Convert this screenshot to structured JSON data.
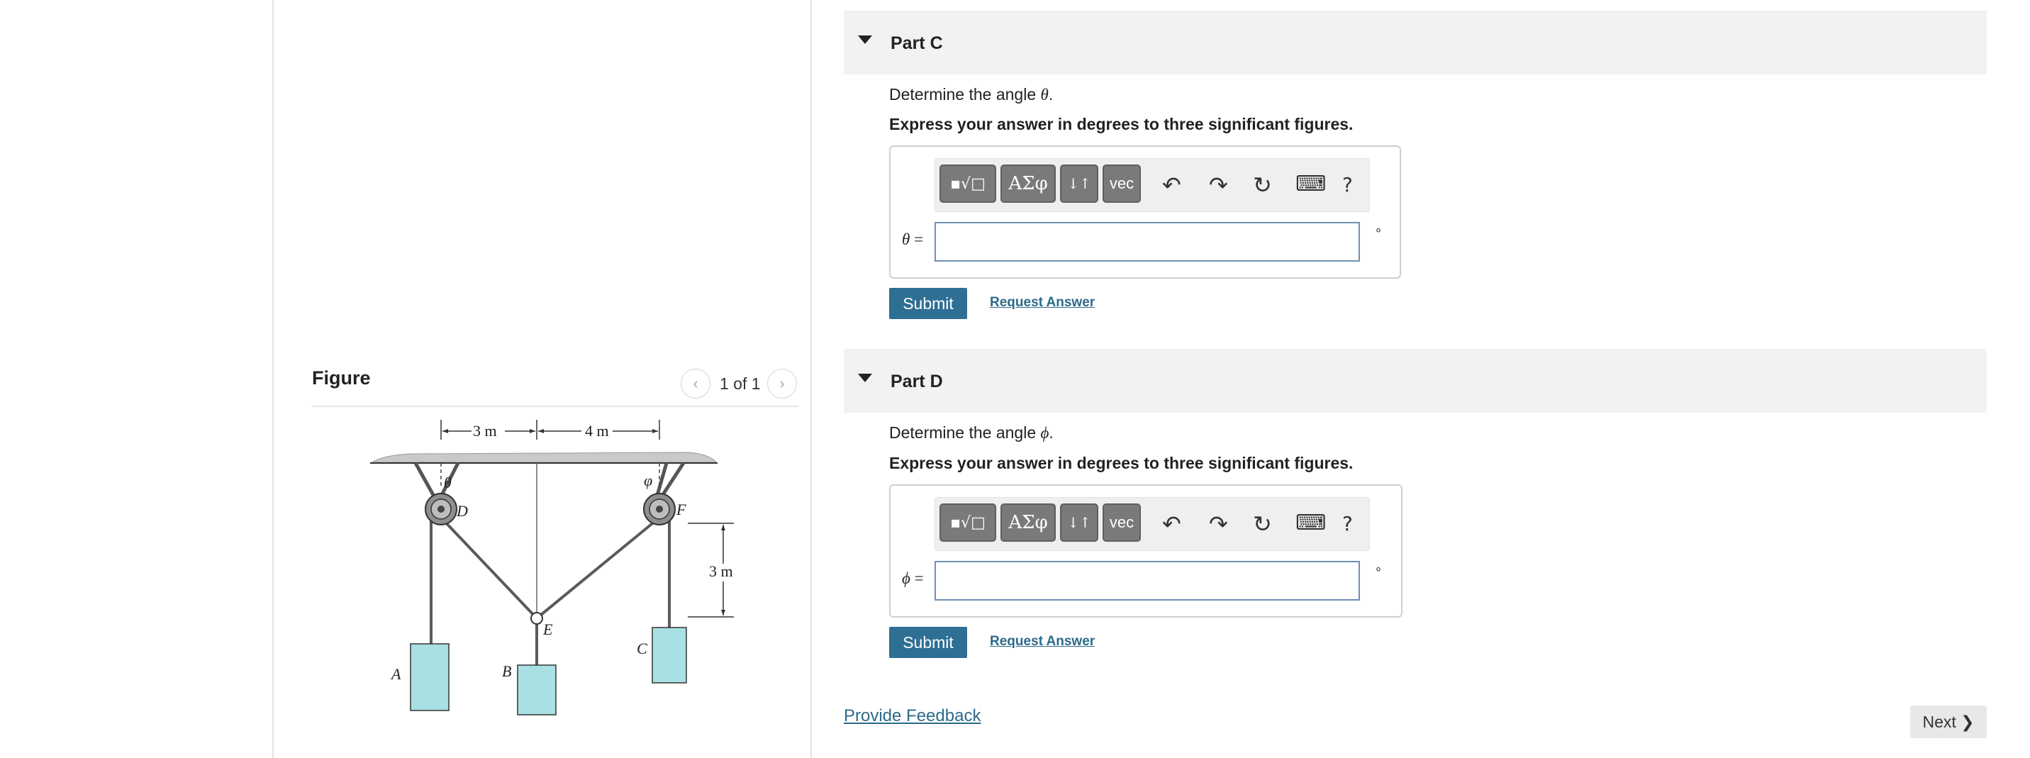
{
  "figure": {
    "title": "Figure",
    "pager": {
      "prev": "‹",
      "count": "1 of 1",
      "next": "›"
    },
    "diagram": {
      "dim_top_left": "3 m",
      "dim_top_right": "4 m",
      "dim_right": "3 m",
      "labels": {
        "theta": "θ",
        "phi": "φ",
        "D": "D",
        "F": "F",
        "E": "E",
        "A": "A",
        "B": "B",
        "C": "C"
      }
    }
  },
  "parts": [
    {
      "title": "Part C",
      "question_prefix": "Determine the angle ",
      "question_symbol": "θ",
      "question_suffix": ".",
      "instruction": "Express your answer in degrees to three significant figures.",
      "variable": "θ",
      "equals": "=",
      "input_value": "",
      "unit": "°",
      "submit_label": "Submit",
      "request_label": "Request Answer"
    },
    {
      "title": "Part D",
      "question_prefix": "Determine the angle ",
      "question_symbol": "ϕ",
      "question_suffix": ".",
      "instruction": "Express your answer in degrees to three significant figures.",
      "variable": "ϕ",
      "equals": "=",
      "input_value": "",
      "unit": "°",
      "submit_label": "Submit",
      "request_label": "Request Answer"
    }
  ],
  "toolbar": {
    "templates_label": "▪√□",
    "greek_label": "ΑΣφ",
    "subsup_label": "↓↑",
    "vec_label": "vec",
    "undo_icon": "↶",
    "redo_icon": "↷",
    "reset_icon": "↻",
    "keyboard_icon": "⌨",
    "help_label": "?"
  },
  "footer": {
    "feedback_label": "Provide Feedback",
    "next_label": "Next ❯"
  }
}
